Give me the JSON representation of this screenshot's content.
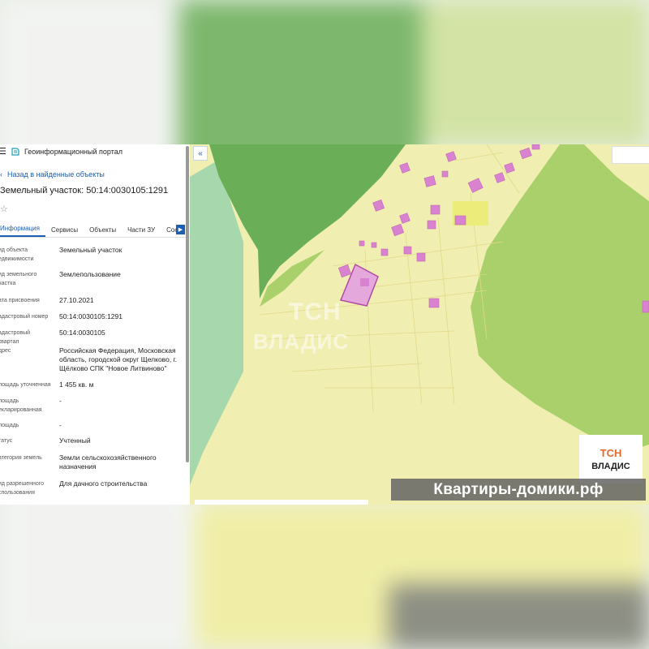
{
  "header": {
    "app_title": "Геоинформационный портал"
  },
  "nav": {
    "back_label": "Назад в найденные объекты"
  },
  "object": {
    "title": "Земельный участок: 50:14:0030105:1291"
  },
  "tabs": [
    {
      "label": "Информация",
      "active": true
    },
    {
      "label": "Сервисы"
    },
    {
      "label": "Объекты"
    },
    {
      "label": "Части ЗУ"
    },
    {
      "label": "Соста"
    }
  ],
  "properties": [
    {
      "label": "ид объекта едвижимости",
      "value": "Земельный участок"
    },
    {
      "label": "ид земельного частка",
      "value": "Землепользование"
    },
    {
      "label": "ата присвоения",
      "value": "27.10.2021"
    },
    {
      "label": "адастровый номер",
      "value": "50:14:0030105:1291"
    },
    {
      "label": "адастровый квартал",
      "value": "50:14:0030105"
    },
    {
      "label": "дрес",
      "value": "Российская Федерация, Московская область, городской округ Щелково, г. Щёлково СПК \"Новое Литвиново\""
    },
    {
      "label": "лощадь уточненная",
      "value": "1 455 кв. м"
    },
    {
      "label": "лощадь екларированная",
      "value": "-"
    },
    {
      "label": "лощадь",
      "value": "-"
    },
    {
      "label": "татус",
      "value": "Учтенный"
    },
    {
      "label": "атегория земель",
      "value": "Земли сельскохозяйственного назначения"
    },
    {
      "label": "ид разрешенного спользования",
      "value": "Для дачного строительства"
    }
  ],
  "watermark": {
    "line1": "ТСН",
    "line2": "ВЛАДИС"
  },
  "badge": {
    "line1": "ТСН",
    "line2": "ВЛАДИС"
  },
  "banner": {
    "text": "Квартиры-домики.рф"
  },
  "icons": {
    "menu": "hamburger-icon",
    "logo": "portal-logo-icon",
    "back": "chevron-left-icon",
    "favorite": "star-icon",
    "tabs_next": "chevron-right-icon",
    "collapse": "double-chevron-left-icon"
  },
  "colors": {
    "link": "#1a5fb4",
    "parcel_fill": "#d983d0",
    "forest_dark": "#6aae58",
    "meadow": "#a9d06a",
    "land_yellow": "#f0eeb0"
  }
}
